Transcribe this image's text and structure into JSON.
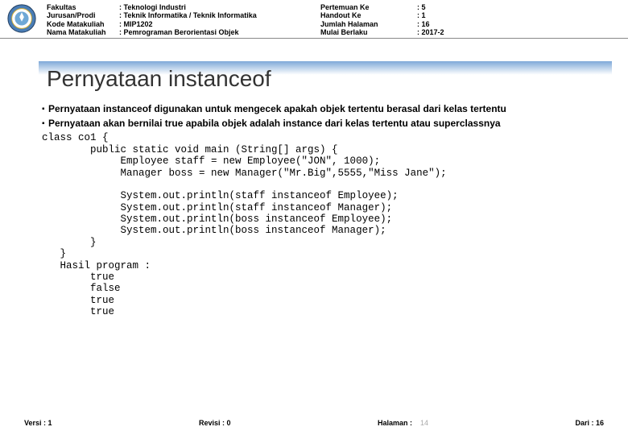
{
  "header": {
    "labels1": [
      "Fakultas",
      "Jurusan/Prodi",
      "Kode Matakuliah",
      "Nama Matakuliah"
    ],
    "values1": [
      ": Teknologi Industri",
      ": Teknik Informatika / Teknik Informatika",
      ": MIP1202",
      ": Pemrograman Berorientasi Objek"
    ],
    "labels2": [
      "Pertemuan Ke",
      "Handout Ke",
      "Jumlah Halaman",
      "Mulai Berlaku"
    ],
    "values2": [
      ": 5",
      ": 1",
      ": 16",
      ": 2017-2"
    ]
  },
  "title": "Pernyataan instanceof",
  "bullets": [
    "Pernyataan instanceof digunakan untuk mengecek apakah objek tertentu berasal dari kelas tertentu",
    "Pernyataan akan bernilai true apabila objek adalah instance dari kelas tertentu atau superclassnya"
  ],
  "code": "class co1 {\n        public static void main (String[] args) {\n             Employee staff = new Employee(\"JON\", 1000);\n             Manager boss = new Manager(\"Mr.Big\",5555,\"Miss Jane\");\n\n             System.out.println(staff instanceof Employee);\n             System.out.println(staff instanceof Manager);\n             System.out.println(boss instanceof Employee);\n             System.out.println(boss instanceof Manager);\n        }\n   }\n   Hasil program :\n        true\n        false\n        true\n        true",
  "footer": {
    "versi_label": "Versi :",
    "versi_val": "1",
    "revisi_label": "Revisi :",
    "revisi_val": "0",
    "halaman_label": "Halaman :",
    "page": "14",
    "dari_label": "Dari :",
    "dari_val": "16"
  }
}
